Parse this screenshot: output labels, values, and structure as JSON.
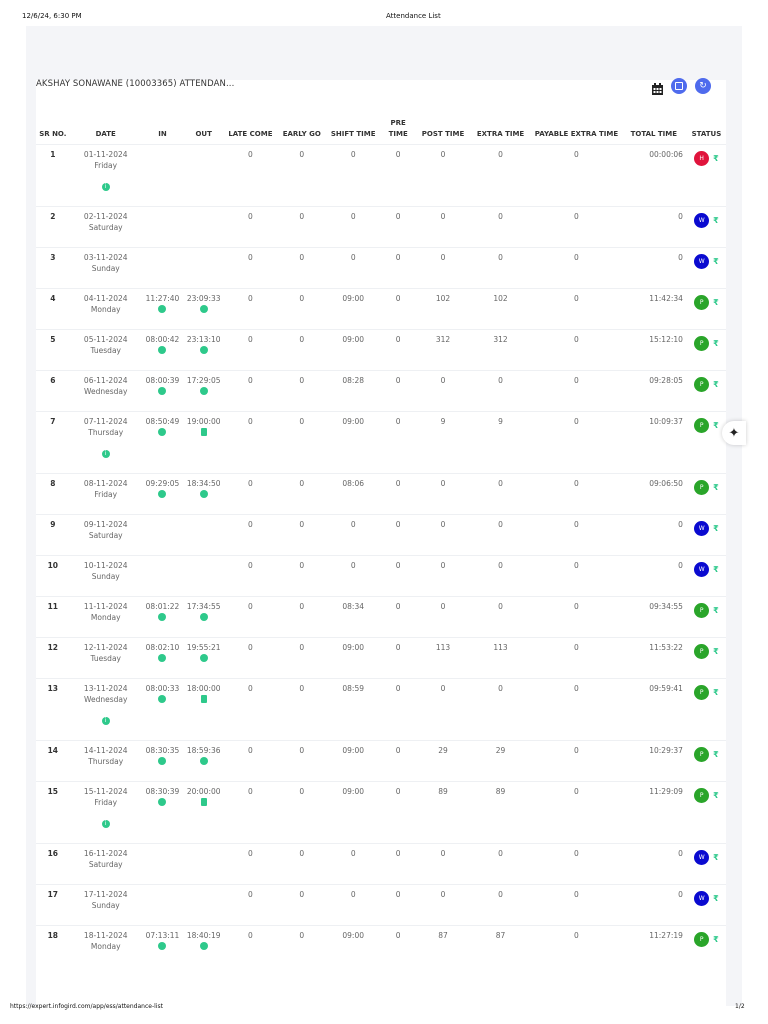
{
  "print_header": {
    "datetime": "12/6/24, 6:30 PM",
    "title": "Attendance List"
  },
  "print_footer": {
    "url": "https://expert.infogird.com/app/ess/attendance-list",
    "page": "1/2"
  },
  "page": {
    "title": "AKSHAY SONAWANE (10003365) ATTENDAN..."
  },
  "toolbar": {
    "calendar": "calendar-icon",
    "save": "save-icon",
    "refresh": "refresh-icon"
  },
  "columns": [
    "SR NO.",
    "DATE",
    "IN",
    "OUT",
    "LATE COME",
    "EARLY GO",
    "SHIFT TIME",
    "PRE TIME",
    "POST TIME",
    "EXTRA TIME",
    "PAYABLE EXTRA TIME",
    "TOTAL TIME",
    "STATUS"
  ],
  "status_colors": {
    "H": "#e0143c",
    "W": "#0a0ad0",
    "P": "#2aa52a"
  },
  "rows": [
    {
      "sr": "1",
      "date": "01-11-2024",
      "day": "Friday",
      "in": "",
      "out": "",
      "in_icon": "",
      "out_icon": "",
      "info": true,
      "late": "0",
      "early": "0",
      "shift": "0",
      "pre": "0",
      "post": "0",
      "extra": "0",
      "payable": "0",
      "total": "00:00:06",
      "status": "H"
    },
    {
      "sr": "2",
      "date": "02-11-2024",
      "day": "Saturday",
      "in": "",
      "out": "",
      "in_icon": "",
      "out_icon": "",
      "info": false,
      "late": "0",
      "early": "0",
      "shift": "0",
      "pre": "0",
      "post": "0",
      "extra": "0",
      "payable": "0",
      "total": "0",
      "status": "W"
    },
    {
      "sr": "3",
      "date": "03-11-2024",
      "day": "Sunday",
      "in": "",
      "out": "",
      "in_icon": "",
      "out_icon": "",
      "info": false,
      "late": "0",
      "early": "0",
      "shift": "0",
      "pre": "0",
      "post": "0",
      "extra": "0",
      "payable": "0",
      "total": "0",
      "status": "W"
    },
    {
      "sr": "4",
      "date": "04-11-2024",
      "day": "Monday",
      "in": "11:27:40",
      "out": "23:09:33",
      "in_icon": "globe",
      "out_icon": "globe",
      "info": false,
      "late": "0",
      "early": "0",
      "shift": "09:00",
      "pre": "0",
      "post": "102",
      "extra": "102",
      "payable": "0",
      "total": "11:42:34",
      "status": "P"
    },
    {
      "sr": "5",
      "date": "05-11-2024",
      "day": "Tuesday",
      "in": "08:00:42",
      "out": "23:13:10",
      "in_icon": "globe",
      "out_icon": "globe",
      "info": false,
      "late": "0",
      "early": "0",
      "shift": "09:00",
      "pre": "0",
      "post": "312",
      "extra": "312",
      "payable": "0",
      "total": "15:12:10",
      "status": "P"
    },
    {
      "sr": "6",
      "date": "06-11-2024",
      "day": "Wednesday",
      "in": "08:00:39",
      "out": "17:29:05",
      "in_icon": "globe",
      "out_icon": "globe",
      "info": false,
      "late": "0",
      "early": "0",
      "shift": "08:28",
      "pre": "0",
      "post": "0",
      "extra": "0",
      "payable": "0",
      "total": "09:28:05",
      "status": "P"
    },
    {
      "sr": "7",
      "date": "07-11-2024",
      "day": "Thursday",
      "in": "08:50:49",
      "out": "19:00:00",
      "in_icon": "globe",
      "out_icon": "document",
      "info": true,
      "late": "0",
      "early": "0",
      "shift": "09:00",
      "pre": "0",
      "post": "9",
      "extra": "9",
      "payable": "0",
      "total": "10:09:37",
      "status": "P"
    },
    {
      "sr": "8",
      "date": "08-11-2024",
      "day": "Friday",
      "in": "09:29:05",
      "out": "18:34:50",
      "in_icon": "globe",
      "out_icon": "globe",
      "info": false,
      "late": "0",
      "early": "0",
      "shift": "08:06",
      "pre": "0",
      "post": "0",
      "extra": "0",
      "payable": "0",
      "total": "09:06:50",
      "status": "P"
    },
    {
      "sr": "9",
      "date": "09-11-2024",
      "day": "Saturday",
      "in": "",
      "out": "",
      "in_icon": "",
      "out_icon": "",
      "info": false,
      "late": "0",
      "early": "0",
      "shift": "0",
      "pre": "0",
      "post": "0",
      "extra": "0",
      "payable": "0",
      "total": "0",
      "status": "W"
    },
    {
      "sr": "10",
      "date": "10-11-2024",
      "day": "Sunday",
      "in": "",
      "out": "",
      "in_icon": "",
      "out_icon": "",
      "info": false,
      "late": "0",
      "early": "0",
      "shift": "0",
      "pre": "0",
      "post": "0",
      "extra": "0",
      "payable": "0",
      "total": "0",
      "status": "W"
    },
    {
      "sr": "11",
      "date": "11-11-2024",
      "day": "Monday",
      "in": "08:01:22",
      "out": "17:34:55",
      "in_icon": "globe",
      "out_icon": "globe",
      "info": false,
      "late": "0",
      "early": "0",
      "shift": "08:34",
      "pre": "0",
      "post": "0",
      "extra": "0",
      "payable": "0",
      "total": "09:34:55",
      "status": "P"
    },
    {
      "sr": "12",
      "date": "12-11-2024",
      "day": "Tuesday",
      "in": "08:02:10",
      "out": "19:55:21",
      "in_icon": "globe",
      "out_icon": "globe",
      "info": false,
      "late": "0",
      "early": "0",
      "shift": "09:00",
      "pre": "0",
      "post": "113",
      "extra": "113",
      "payable": "0",
      "total": "11:53:22",
      "status": "P"
    },
    {
      "sr": "13",
      "date": "13-11-2024",
      "day": "Wednesday",
      "in": "08:00:33",
      "out": "18:00:00",
      "in_icon": "globe",
      "out_icon": "document",
      "info": true,
      "late": "0",
      "early": "0",
      "shift": "08:59",
      "pre": "0",
      "post": "0",
      "extra": "0",
      "payable": "0",
      "total": "09:59:41",
      "status": "P"
    },
    {
      "sr": "14",
      "date": "14-11-2024",
      "day": "Thursday",
      "in": "08:30:35",
      "out": "18:59:36",
      "in_icon": "globe",
      "out_icon": "globe",
      "info": false,
      "late": "0",
      "early": "0",
      "shift": "09:00",
      "pre": "0",
      "post": "29",
      "extra": "29",
      "payable": "0",
      "total": "10:29:37",
      "status": "P"
    },
    {
      "sr": "15",
      "date": "15-11-2024",
      "day": "Friday",
      "in": "08:30:39",
      "out": "20:00:00",
      "in_icon": "globe",
      "out_icon": "document",
      "info": true,
      "late": "0",
      "early": "0",
      "shift": "09:00",
      "pre": "0",
      "post": "89",
      "extra": "89",
      "payable": "0",
      "total": "11:29:09",
      "status": "P"
    },
    {
      "sr": "16",
      "date": "16-11-2024",
      "day": "Saturday",
      "in": "",
      "out": "",
      "in_icon": "",
      "out_icon": "",
      "info": false,
      "late": "0",
      "early": "0",
      "shift": "0",
      "pre": "0",
      "post": "0",
      "extra": "0",
      "payable": "0",
      "total": "0",
      "status": "W"
    },
    {
      "sr": "17",
      "date": "17-11-2024",
      "day": "Sunday",
      "in": "",
      "out": "",
      "in_icon": "",
      "out_icon": "",
      "info": false,
      "late": "0",
      "early": "0",
      "shift": "0",
      "pre": "0",
      "post": "0",
      "extra": "0",
      "payable": "0",
      "total": "0",
      "status": "W"
    },
    {
      "sr": "18",
      "date": "18-11-2024",
      "day": "Monday",
      "in": "07:13:11",
      "out": "18:40:19",
      "in_icon": "globe",
      "out_icon": "globe",
      "info": false,
      "late": "0",
      "early": "0",
      "shift": "09:00",
      "pre": "0",
      "post": "87",
      "extra": "87",
      "payable": "0",
      "total": "11:27:19",
      "status": "P"
    }
  ]
}
